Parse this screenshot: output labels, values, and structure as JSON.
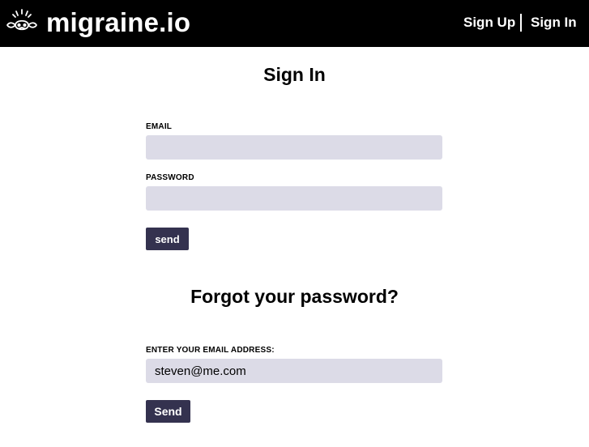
{
  "header": {
    "logo_text": "migraine.io",
    "logo_icon": "migraine-head-icon",
    "nav": {
      "signup_label": "Sign Up",
      "signin_label": "Sign In"
    }
  },
  "signin": {
    "title": "Sign In",
    "email_label": "EMAIL",
    "email_value": "",
    "password_label": "PASSWORD",
    "password_value": "",
    "submit_label": "send"
  },
  "forgot": {
    "title": "Forgot your password?",
    "email_label": "ENTER YOUR EMAIL ADDRESS:",
    "email_value": "steven@me.com",
    "submit_label": "Send"
  },
  "colors": {
    "header_bg": "#000000",
    "field_bg": "#dcdbe7",
    "button_bg": "#34324f"
  }
}
